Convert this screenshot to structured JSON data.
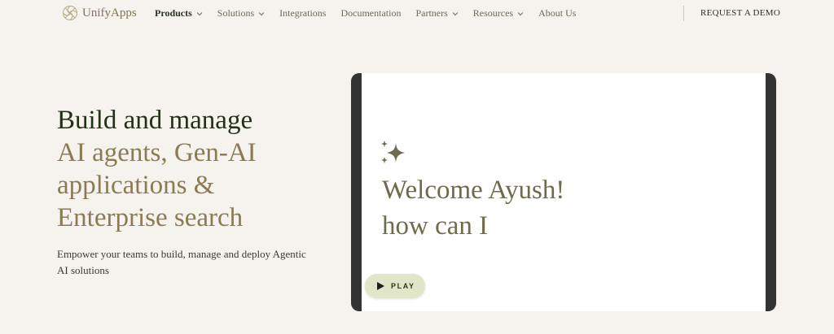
{
  "brand": {
    "name": "UnifyApps",
    "logo_icon": "swirl-logo-icon"
  },
  "nav": {
    "items": [
      {
        "label": "Products",
        "has_dropdown": true,
        "active": true
      },
      {
        "label": "Solutions",
        "has_dropdown": true,
        "active": false
      },
      {
        "label": "Integrations",
        "has_dropdown": false,
        "active": false
      },
      {
        "label": "Documentation",
        "has_dropdown": false,
        "active": false
      },
      {
        "label": "Partners",
        "has_dropdown": true,
        "active": false
      },
      {
        "label": "Resources",
        "has_dropdown": true,
        "active": false
      },
      {
        "label": "About Us",
        "has_dropdown": false,
        "active": false
      }
    ],
    "cta": "REQUEST A DEMO"
  },
  "hero": {
    "headline": "Build and manage",
    "highlight_lines": [
      "AI agents, Gen-AI",
      "applications &",
      "Enterprise search"
    ],
    "subtitle": "Empower your teams to build, manage and deploy Agentic AI solutions"
  },
  "video": {
    "icon": "sparkle-icon",
    "welcome_line1": "Welcome Ayush!",
    "welcome_line2": "how can I",
    "play_label": "PLAY"
  },
  "colors": {
    "background": "#f6f3ee",
    "headline": "#1f3116",
    "highlight": "#8a7b52",
    "card_frame": "#333333",
    "play_button": "#e2e6c8",
    "sparkle": "#6b6d4d"
  }
}
